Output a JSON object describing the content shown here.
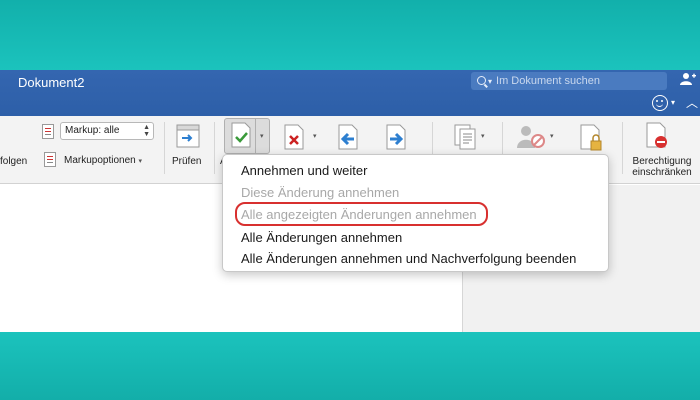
{
  "window": {
    "title": "Dokument2",
    "search_placeholder": "Im Dokument suchen"
  },
  "ribbon": {
    "follow_label_partial": "folgen",
    "markup_select_value": "Markup: alle",
    "markup_options_label": "Markupoptionen",
    "review_label": "Prüfen",
    "accept_label_partial": "A",
    "restrict_label_line1": "Berechtigung",
    "restrict_label_line2": "einschränken"
  },
  "accept_menu": {
    "items": [
      {
        "label": "Annehmen und weiter",
        "enabled": true
      },
      {
        "label": "Diese Änderung annehmen",
        "enabled": false
      },
      {
        "label": "Alle angezeigten Änderungen annehmen",
        "enabled": false
      },
      {
        "label": "Alle Änderungen annehmen",
        "enabled": true
      },
      {
        "label": "Alle Änderungen annehmen und Nachverfolgung beenden",
        "enabled": true
      }
    ]
  },
  "colors": {
    "titlebar": "#2d5fa8",
    "background": "#19bfb9",
    "highlight": "#d8302f",
    "accept_check": "#3a9a3a",
    "reject_x": "#cc2222",
    "nav_arrow": "#2d7fd0"
  }
}
